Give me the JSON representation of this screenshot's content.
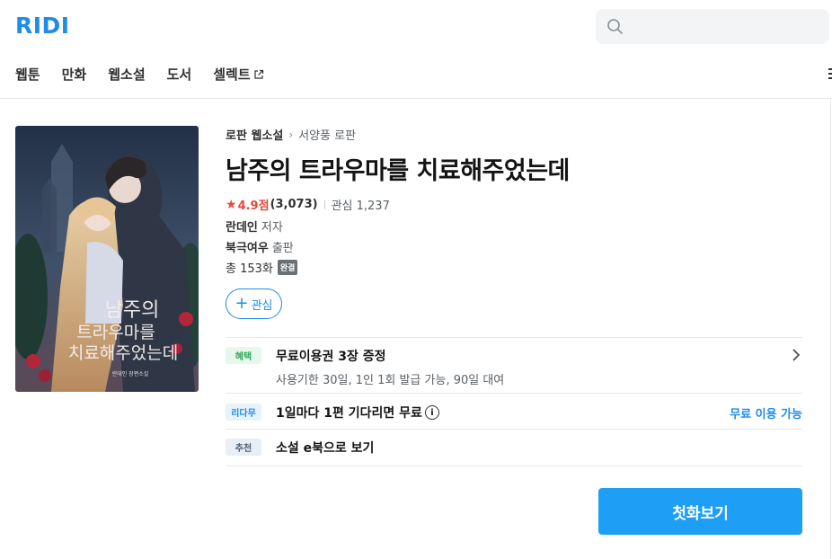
{
  "header": {
    "logo": "RIDI",
    "nav": [
      {
        "label": "웹툰"
      },
      {
        "label": "만화"
      },
      {
        "label": "웹소설"
      },
      {
        "label": "도서"
      },
      {
        "label": "셀렉트"
      }
    ]
  },
  "cover": {
    "title_text": "남주의 트라우마를 치료해주었는데",
    "author_text": "란데인 장편소설"
  },
  "book": {
    "breadcrumb": [
      "로판 웹소설",
      "서양풍 로판"
    ],
    "title": "남주의 트라우마를 치료해주었는데",
    "rating": "4.9점",
    "rating_count": "(3,073)",
    "interest": "관심 1,237",
    "author_name": "란데인",
    "author_role": "저자",
    "publisher_name": "북극여우",
    "publisher_role": "출판",
    "episodes": "총 153화",
    "status_badge": "완결",
    "favorite_label": "관심"
  },
  "benefits": [
    {
      "tag": "혜택",
      "main": "무료이용권 3장 증정",
      "sub": "사용기한 30일, 1인 1회 발급 가능, 90일 대여"
    },
    {
      "tag": "리다무",
      "main": "1일마다 1편 기다리면 무료",
      "right": "무료 이용 가능"
    },
    {
      "tag": "추천",
      "main": "소설 e북으로 보기"
    }
  ],
  "cta": {
    "label": "첫화보기"
  },
  "colors": {
    "brand": "#1f8ce6",
    "cta": "#1f9ef5",
    "rating": "#e64938"
  }
}
